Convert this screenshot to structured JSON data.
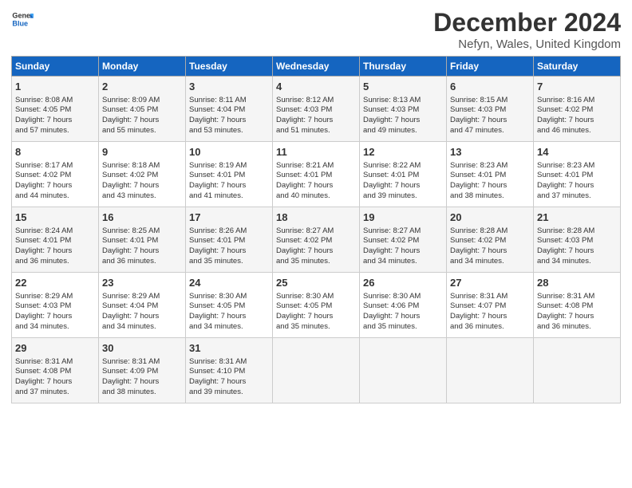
{
  "header": {
    "logo_line1": "General",
    "logo_line2": "Blue",
    "main_title": "December 2024",
    "subtitle": "Nefyn, Wales, United Kingdom"
  },
  "days_of_week": [
    "Sunday",
    "Monday",
    "Tuesday",
    "Wednesday",
    "Thursday",
    "Friday",
    "Saturday"
  ],
  "weeks": [
    [
      {
        "day": 1,
        "info": "Sunrise: 8:08 AM\nSunset: 4:05 PM\nDaylight: 7 hours\nand 57 minutes."
      },
      {
        "day": 2,
        "info": "Sunrise: 8:09 AM\nSunset: 4:05 PM\nDaylight: 7 hours\nand 55 minutes."
      },
      {
        "day": 3,
        "info": "Sunrise: 8:11 AM\nSunset: 4:04 PM\nDaylight: 7 hours\nand 53 minutes."
      },
      {
        "day": 4,
        "info": "Sunrise: 8:12 AM\nSunset: 4:03 PM\nDaylight: 7 hours\nand 51 minutes."
      },
      {
        "day": 5,
        "info": "Sunrise: 8:13 AM\nSunset: 4:03 PM\nDaylight: 7 hours\nand 49 minutes."
      },
      {
        "day": 6,
        "info": "Sunrise: 8:15 AM\nSunset: 4:03 PM\nDaylight: 7 hours\nand 47 minutes."
      },
      {
        "day": 7,
        "info": "Sunrise: 8:16 AM\nSunset: 4:02 PM\nDaylight: 7 hours\nand 46 minutes."
      }
    ],
    [
      {
        "day": 8,
        "info": "Sunrise: 8:17 AM\nSunset: 4:02 PM\nDaylight: 7 hours\nand 44 minutes."
      },
      {
        "day": 9,
        "info": "Sunrise: 8:18 AM\nSunset: 4:02 PM\nDaylight: 7 hours\nand 43 minutes."
      },
      {
        "day": 10,
        "info": "Sunrise: 8:19 AM\nSunset: 4:01 PM\nDaylight: 7 hours\nand 41 minutes."
      },
      {
        "day": 11,
        "info": "Sunrise: 8:21 AM\nSunset: 4:01 PM\nDaylight: 7 hours\nand 40 minutes."
      },
      {
        "day": 12,
        "info": "Sunrise: 8:22 AM\nSunset: 4:01 PM\nDaylight: 7 hours\nand 39 minutes."
      },
      {
        "day": 13,
        "info": "Sunrise: 8:23 AM\nSunset: 4:01 PM\nDaylight: 7 hours\nand 38 minutes."
      },
      {
        "day": 14,
        "info": "Sunrise: 8:23 AM\nSunset: 4:01 PM\nDaylight: 7 hours\nand 37 minutes."
      }
    ],
    [
      {
        "day": 15,
        "info": "Sunrise: 8:24 AM\nSunset: 4:01 PM\nDaylight: 7 hours\nand 36 minutes."
      },
      {
        "day": 16,
        "info": "Sunrise: 8:25 AM\nSunset: 4:01 PM\nDaylight: 7 hours\nand 36 minutes."
      },
      {
        "day": 17,
        "info": "Sunrise: 8:26 AM\nSunset: 4:01 PM\nDaylight: 7 hours\nand 35 minutes."
      },
      {
        "day": 18,
        "info": "Sunrise: 8:27 AM\nSunset: 4:02 PM\nDaylight: 7 hours\nand 35 minutes."
      },
      {
        "day": 19,
        "info": "Sunrise: 8:27 AM\nSunset: 4:02 PM\nDaylight: 7 hours\nand 34 minutes."
      },
      {
        "day": 20,
        "info": "Sunrise: 8:28 AM\nSunset: 4:02 PM\nDaylight: 7 hours\nand 34 minutes."
      },
      {
        "day": 21,
        "info": "Sunrise: 8:28 AM\nSunset: 4:03 PM\nDaylight: 7 hours\nand 34 minutes."
      }
    ],
    [
      {
        "day": 22,
        "info": "Sunrise: 8:29 AM\nSunset: 4:03 PM\nDaylight: 7 hours\nand 34 minutes."
      },
      {
        "day": 23,
        "info": "Sunrise: 8:29 AM\nSunset: 4:04 PM\nDaylight: 7 hours\nand 34 minutes."
      },
      {
        "day": 24,
        "info": "Sunrise: 8:30 AM\nSunset: 4:05 PM\nDaylight: 7 hours\nand 34 minutes."
      },
      {
        "day": 25,
        "info": "Sunrise: 8:30 AM\nSunset: 4:05 PM\nDaylight: 7 hours\nand 35 minutes."
      },
      {
        "day": 26,
        "info": "Sunrise: 8:30 AM\nSunset: 4:06 PM\nDaylight: 7 hours\nand 35 minutes."
      },
      {
        "day": 27,
        "info": "Sunrise: 8:31 AM\nSunset: 4:07 PM\nDaylight: 7 hours\nand 36 minutes."
      },
      {
        "day": 28,
        "info": "Sunrise: 8:31 AM\nSunset: 4:08 PM\nDaylight: 7 hours\nand 36 minutes."
      }
    ],
    [
      {
        "day": 29,
        "info": "Sunrise: 8:31 AM\nSunset: 4:08 PM\nDaylight: 7 hours\nand 37 minutes."
      },
      {
        "day": 30,
        "info": "Sunrise: 8:31 AM\nSunset: 4:09 PM\nDaylight: 7 hours\nand 38 minutes."
      },
      {
        "day": 31,
        "info": "Sunrise: 8:31 AM\nSunset: 4:10 PM\nDaylight: 7 hours\nand 39 minutes."
      },
      {
        "day": "",
        "info": ""
      },
      {
        "day": "",
        "info": ""
      },
      {
        "day": "",
        "info": ""
      },
      {
        "day": "",
        "info": ""
      }
    ]
  ]
}
